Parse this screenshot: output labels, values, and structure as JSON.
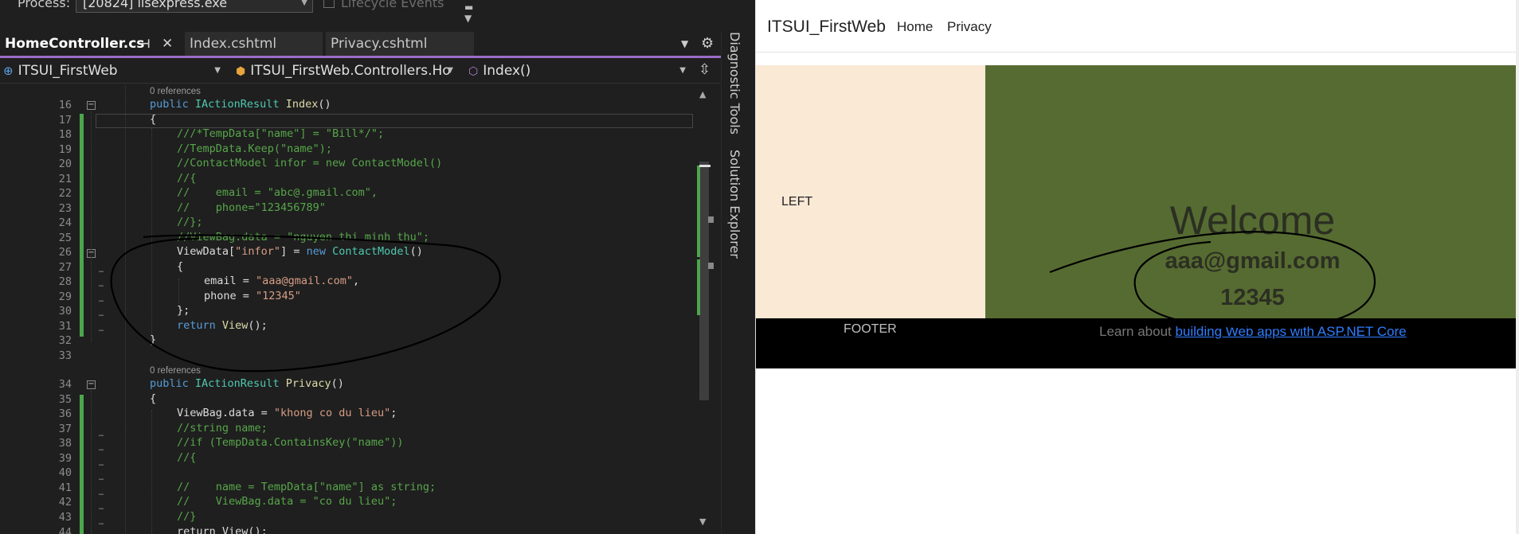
{
  "ide": {
    "process_label": "Process:",
    "process_value": "[20824] iisexpress.exe",
    "lifecycle_label": "Lifecycle Events",
    "tabs": [
      {
        "label": "HomeController.cs",
        "active": true
      },
      {
        "label": "Index.cshtml",
        "active": false
      },
      {
        "label": "Privacy.cshtml",
        "active": false
      }
    ],
    "nav": {
      "project": "ITSUI_FirstWeb",
      "class": "ITSUI_FirstWeb.Controllers.Ho",
      "member": "Index()"
    },
    "right_rail": {
      "diagnostic_tools": "Diagnostic Tools",
      "solution_explorer": "Solution Explorer"
    },
    "codelens_1": "0 references",
    "codelens_2": "0 references",
    "line_numbers": [
      "16",
      "17",
      "18",
      "19",
      "20",
      "21",
      "22",
      "23",
      "24",
      "25",
      "26",
      "27",
      "28",
      "29",
      "30",
      "31",
      "32",
      "33",
      "34",
      "35",
      "36",
      "37",
      "38",
      "39",
      "40",
      "41",
      "42",
      "43",
      "44"
    ],
    "code": {
      "l16": {
        "a": "public ",
        "b": "IActionResult ",
        "c": "Index",
        "d": "()"
      },
      "l17": "{",
      "l18": "///*TempData[\"name\"] = \"Bill*/\";",
      "l19": "//TempData.Keep(\"name\");",
      "l20": "//ContactModel infor = new ContactModel()",
      "l21": "//{",
      "l22": "//    email = \"abc@.gmail.com\",",
      "l23": "//    phone=\"123456789\"",
      "l24": "//};",
      "l25": "//ViewBag.data = \"nguyen thi minh thu\";",
      "l26": {
        "a": "ViewData[",
        "b": "\"infor\"",
        "c": "] = ",
        "d": "new ",
        "e": "ContactModel",
        "f": "()"
      },
      "l27": "{",
      "l28": {
        "a": "email = ",
        "b": "\"aaa@gmail.com\"",
        "c": ","
      },
      "l29": {
        "a": "phone = ",
        "b": "\"12345\""
      },
      "l30": "};",
      "l31": {
        "a": "return ",
        "b": "View",
        "c": "();"
      },
      "l32": "}",
      "l34": {
        "a": "public ",
        "b": "IActionResult ",
        "c": "Privacy",
        "d": "()"
      },
      "l35": "{",
      "l36": {
        "a": "ViewBag.data = ",
        "b": "\"khong co du lieu\"",
        "c": ";"
      },
      "l37": "//string name;",
      "l38": "//if (TempData.ContainsKey(\"name\"))",
      "l39": "//{",
      "l41": "//    name = TempData[\"name\"] as string;",
      "l42": "//    ViewBag.data = \"co du lieu\";",
      "l43": "//}",
      "l44": "return View();"
    }
  },
  "browser": {
    "brand": "ITSUI_FirstWeb",
    "nav_home": "Home",
    "nav_privacy": "Privacy",
    "left_label": "LEFT",
    "welcome": "Welcome",
    "email": "aaa@gmail.com",
    "phone": "12345",
    "footer_label": "FOOTER",
    "footer_text": "Learn about ",
    "footer_link": "building Web apps with ASP.NET Core"
  },
  "colors": {
    "ide_bg": "#1f1f1f",
    "tab_accent": "#9b6cc7",
    "change_bar": "#4ca64c",
    "keyword": "#569cd6",
    "type": "#4ec9b0",
    "method": "#dcdcaa",
    "string": "#d69d85",
    "comment": "#57a64a",
    "left_panel": "#f9e9d5",
    "main_panel": "#566b31",
    "footer_bg": "#000000",
    "link": "#2f7dff"
  }
}
